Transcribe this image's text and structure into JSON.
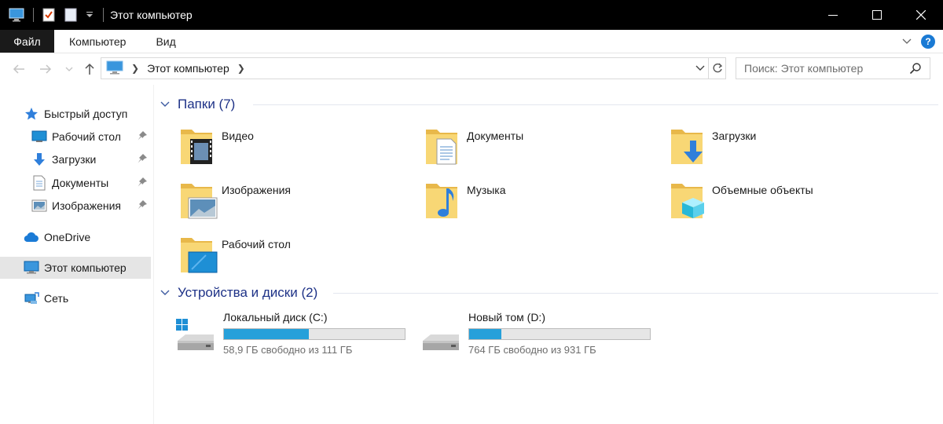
{
  "window": {
    "title": "Этот компьютер"
  },
  "ribbon": {
    "tabs": [
      "Файл",
      "Компьютер",
      "Вид"
    ]
  },
  "address": {
    "crumbs": [
      "Этот компьютер"
    ]
  },
  "search": {
    "placeholder": "Поиск: Этот компьютер"
  },
  "nav": {
    "items": [
      {
        "label": "Быстрый доступ",
        "icon": "star-icon"
      },
      {
        "label": "Рабочий стол",
        "icon": "desktop-icon",
        "pinned": true
      },
      {
        "label": "Загрузки",
        "icon": "download-icon",
        "pinned": true
      },
      {
        "label": "Документы",
        "icon": "document-icon",
        "pinned": true
      },
      {
        "label": "Изображения",
        "icon": "pictures-icon",
        "pinned": true
      },
      {
        "label": "OneDrive",
        "icon": "cloud-icon"
      },
      {
        "label": "Этот компьютер",
        "icon": "computer-icon",
        "selected": true
      },
      {
        "label": "Сеть",
        "icon": "network-icon"
      }
    ]
  },
  "folders_group": {
    "title": "Папки (7)",
    "items": [
      {
        "label": "Видео",
        "icon": "video-folder-icon"
      },
      {
        "label": "Документы",
        "icon": "documents-folder-icon"
      },
      {
        "label": "Загрузки",
        "icon": "downloads-folder-icon"
      },
      {
        "label": "Изображения",
        "icon": "pictures-folder-icon"
      },
      {
        "label": "Музыка",
        "icon": "music-folder-icon"
      },
      {
        "label": "Объемные объекты",
        "icon": "3d-objects-folder-icon"
      },
      {
        "label": "Рабочий стол",
        "icon": "desktop-folder-icon"
      }
    ]
  },
  "drives_group": {
    "title": "Устройства и диски (2)",
    "items": [
      {
        "label": "Локальный диск (C:)",
        "free_text": "58,9 ГБ свободно из 111 ГБ",
        "used_fraction": 0.47,
        "icon": "system-drive-icon"
      },
      {
        "label": "Новый том (D:)",
        "free_text": "764 ГБ свободно из 931 ГБ",
        "used_fraction": 0.18,
        "icon": "drive-icon"
      }
    ]
  },
  "colors": {
    "accent": "#26a0da",
    "group_title": "#1e3287",
    "folder": "#f8d775"
  }
}
